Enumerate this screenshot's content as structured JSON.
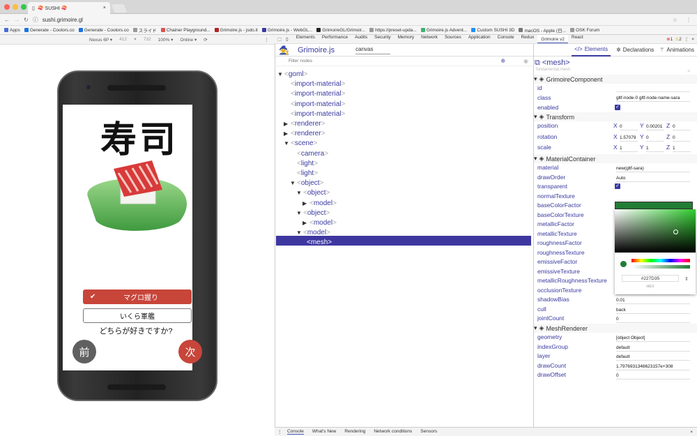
{
  "browser": {
    "tab_title": "🍣 SUSHI 🍣",
    "url": "sushi.grimoire.gl",
    "bookmarks": [
      {
        "label": "Apps",
        "color": "#4a6cd4"
      },
      {
        "label": "Generate - Coolors.co",
        "color": "#1b74e4"
      },
      {
        "label": "Generate - Coolors.co",
        "color": "#1b74e4"
      },
      {
        "label": "スライド",
        "color": "#999999"
      },
      {
        "label": "Chainer Playground...",
        "color": "#d9534f"
      },
      {
        "label": "Grimoire.js - jsdo.it",
        "color": "#b22222"
      },
      {
        "label": "Grimoire.js - WebGL...",
        "color": "#3a3aa0"
      },
      {
        "label": "GrimoireGL/Grimoir...",
        "color": "#222222"
      },
      {
        "label": "https://preset-upda...",
        "color": "#999999"
      },
      {
        "label": "Grimoire.js Advent...",
        "color": "#3cb371"
      },
      {
        "label": "Custom SUSHI 3D",
        "color": "#1e90ff"
      },
      {
        "label": "macOS - Apple (日...",
        "color": "#777777"
      },
      {
        "label": "OSK Forum",
        "color": "#999999"
      }
    ]
  },
  "device_toolbar": {
    "device": "Nexus 6P ▾",
    "width": "412",
    "times": "×",
    "height": "732",
    "zoom": "100% ▾",
    "network": "Online ▾"
  },
  "app": {
    "title_kanji": "寿司",
    "choice_selected": "マグロ握り",
    "choice_selected_check": "✔",
    "choice_other": "いくら軍艦",
    "question": "どちらが好きですか?",
    "prev_label": "前",
    "next_label": "次",
    "prev_color": "#606060",
    "next_color": "#c8453a"
  },
  "devtools": {
    "tabs": [
      "Elements",
      "Performance",
      "Audits",
      "Security",
      "Memory",
      "Network",
      "Sources",
      "Application",
      "Console",
      "Redux",
      "Grimoire v2",
      "React"
    ],
    "active_tab": "Grimoire v2",
    "grimoire_title": "Grimoire.js",
    "canvas_select": "canvas",
    "filter_placeholder": "Filter nodes",
    "subtabs": {
      "elements": "Elements",
      "declarations": "Declarations",
      "animations": "Animations"
    },
    "errors": "1",
    "warnings": "2",
    "drawer_tabs": [
      "Console",
      "What's New",
      "Rendering",
      "Network conditions",
      "Sensors"
    ]
  },
  "tree": [
    {
      "name": "goml",
      "depth": 0,
      "arrow": "▼"
    },
    {
      "name": "import-material",
      "depth": 1,
      "arrow": ""
    },
    {
      "name": "import-material",
      "depth": 1,
      "arrow": ""
    },
    {
      "name": "import-material",
      "depth": 1,
      "arrow": ""
    },
    {
      "name": "import-material",
      "depth": 1,
      "arrow": ""
    },
    {
      "name": "renderer",
      "depth": 1,
      "arrow": "▶"
    },
    {
      "name": "renderer",
      "depth": 1,
      "arrow": "▶"
    },
    {
      "name": "scene",
      "depth": 1,
      "arrow": "▼"
    },
    {
      "name": "camera",
      "depth": 2,
      "arrow": ""
    },
    {
      "name": "light",
      "depth": 2,
      "arrow": ""
    },
    {
      "name": "light",
      "depth": 2,
      "arrow": ""
    },
    {
      "name": "object",
      "depth": 2,
      "arrow": "▼"
    },
    {
      "name": "object",
      "depth": 3,
      "arrow": "▼"
    },
    {
      "name": "model",
      "depth": 4,
      "arrow": "▶"
    },
    {
      "name": "object",
      "depth": 3,
      "arrow": "▼"
    },
    {
      "name": "model",
      "depth": 4,
      "arrow": "▶"
    },
    {
      "name": "model",
      "depth": 3,
      "arrow": "▼"
    },
    {
      "name": "mesh",
      "depth": 4,
      "arrow": "",
      "selected": true
    }
  ],
  "inspector": {
    "node": "<mesh>",
    "material_sub": "fundamental.mesh",
    "sections": {
      "grimoire": "GrimoireComponent",
      "transform": "Transform",
      "material": "MaterialContainer",
      "renderer": "MeshRenderer"
    },
    "grimoire_props": {
      "id": "id",
      "class": "class",
      "class_value": "gltf-node-0 gltf-node-name-sara",
      "enabled": "enabled"
    },
    "transform_props": {
      "position": "position",
      "pos_x": "0",
      "pos_y": "0.00201",
      "pos_z": "0",
      "rotation": "rotation",
      "rot_x": "1.57079",
      "rot_y": "0",
      "rot_z": "0",
      "scale": "scale",
      "sc_x": "1",
      "sc_y": "1",
      "sc_z": "1",
      "X": "X",
      "Y": "Y",
      "Z": "Z"
    },
    "material_props": [
      {
        "k": "material",
        "v": "new(gltf-sara)"
      },
      {
        "k": "drawOrder",
        "v": "Auto"
      },
      {
        "k": "transparent",
        "v": "☑"
      },
      {
        "k": "normalTexture",
        "v": ""
      },
      {
        "k": "baseColorFactor",
        "v": ""
      },
      {
        "k": "baseColorTexture",
        "v": ""
      },
      {
        "k": "metallicFactor",
        "v": ""
      },
      {
        "k": "metallicTexture",
        "v": ""
      },
      {
        "k": "roughnessFactor",
        "v": ""
      },
      {
        "k": "roughnessTexture",
        "v": ""
      },
      {
        "k": "emissiveFactor",
        "v": ""
      },
      {
        "k": "emissiveTexture",
        "v": ""
      },
      {
        "k": "metallicRoughnessTexture",
        "v": ""
      },
      {
        "k": "occlusionTexture",
        "v": ""
      },
      {
        "k": "shadowBias",
        "v": "0.01"
      },
      {
        "k": "cull",
        "v": "back"
      },
      {
        "k": "jointCount",
        "v": "0"
      }
    ],
    "renderer_props": [
      {
        "k": "geometry",
        "v": "[object Object]"
      },
      {
        "k": "indexGroup",
        "v": "default"
      },
      {
        "k": "layer",
        "v": "default"
      },
      {
        "k": "drawCount",
        "v": "1.7976931348623157e+308"
      },
      {
        "k": "drawOffset",
        "v": "0"
      }
    ],
    "picker": {
      "hex": "#227D35",
      "mode": "HEX",
      "color": "#227D35"
    }
  }
}
